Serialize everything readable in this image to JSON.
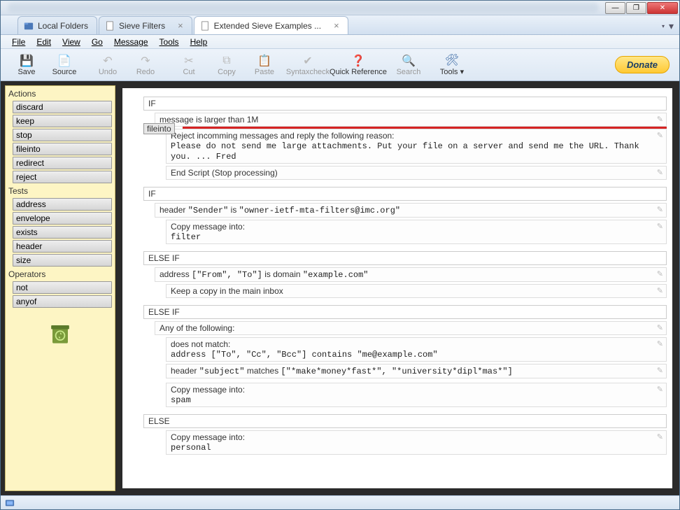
{
  "window_controls": {
    "min": "—",
    "max": "❐",
    "close": "✕"
  },
  "tabs": [
    {
      "label": "Local Folders",
      "icon": "folder",
      "closable": false
    },
    {
      "label": "Sieve Filters",
      "icon": "page",
      "closable": true
    },
    {
      "label": "Extended Sieve Examples ...",
      "icon": "page",
      "closable": true,
      "active": true
    }
  ],
  "menu": [
    "File",
    "Edit",
    "View",
    "Go",
    "Message",
    "Tools",
    "Help"
  ],
  "toolbar": [
    {
      "label": "Save",
      "icon": "💾",
      "enabled": true
    },
    {
      "label": "Source",
      "icon": "📄",
      "enabled": true
    },
    {
      "sep": true
    },
    {
      "label": "Undo",
      "icon": "↶",
      "enabled": false
    },
    {
      "label": "Redo",
      "icon": "↷",
      "enabled": false
    },
    {
      "sep": true
    },
    {
      "label": "Cut",
      "icon": "✂",
      "enabled": false
    },
    {
      "label": "Copy",
      "icon": "⧉",
      "enabled": false
    },
    {
      "label": "Paste",
      "icon": "📋",
      "enabled": false
    },
    {
      "sep": true
    },
    {
      "label": "Syntaxcheck",
      "icon": "✔",
      "enabled": false
    },
    {
      "label": "Quick Reference",
      "icon": "❓",
      "enabled": true,
      "wide": true
    },
    {
      "label": "Search",
      "icon": "🔍",
      "enabled": false
    },
    {
      "sep": true
    },
    {
      "label": "Tools",
      "icon": "🛠",
      "enabled": true,
      "dropdown": true
    }
  ],
  "donate_label": "Donate",
  "sidebar": {
    "sections": [
      {
        "title": "Actions",
        "items": [
          "discard",
          "keep",
          "stop",
          "fileinto",
          "redirect",
          "reject"
        ]
      },
      {
        "title": "Tests",
        "items": [
          "address",
          "envelope",
          "exists",
          "header",
          "size"
        ]
      },
      {
        "title": "Operators",
        "items": [
          "not",
          "anyof"
        ]
      }
    ]
  },
  "drag": {
    "label": "fileinto"
  },
  "script": [
    {
      "kw": "IF",
      "test": "message is larger than 1M",
      "body": [
        {
          "type": "multiline",
          "title": "Reject incomming messages and reply the following reason:",
          "code": "Please do not send me large attachments. Put your file on a server and send me the URL. Thank you. ... Fred"
        },
        {
          "type": "line",
          "text": "End Script (Stop processing)"
        }
      ]
    },
    {
      "kw": "IF",
      "test_html": "header <span class='mono'>\"Sender\"</span> is <span class='mono'>\"owner-ietf-mta-filters@imc.org\"</span>",
      "body": [
        {
          "type": "multiline",
          "title": "Copy message into:",
          "code": "filter"
        }
      ]
    },
    {
      "kw": "ELSE IF",
      "test_html": "address <span class='mono'>[\"From\", \"To\"]</span> is domain <span class='mono'>\"example.com\"</span>",
      "body": [
        {
          "type": "line",
          "text": "Keep a copy in the main inbox"
        }
      ]
    },
    {
      "kw": "ELSE IF",
      "test": "Any of the following:",
      "subtests": [
        {
          "title": "does not match:",
          "code": "address [\"To\", \"Cc\", \"Bcc\"] contains \"me@example.com\""
        },
        {
          "code_html": "header <span class='mono'>\"subject\"</span> matches <span class='mono'>[\"*make*money*fast*\", \"*university*dipl*mas*\"]</span>"
        }
      ],
      "body": [
        {
          "type": "multiline",
          "title": "Copy message into:",
          "code": "spam"
        }
      ]
    },
    {
      "kw": "ELSE",
      "body": [
        {
          "type": "multiline",
          "title": "Copy message into:",
          "code": "personal"
        }
      ]
    }
  ]
}
